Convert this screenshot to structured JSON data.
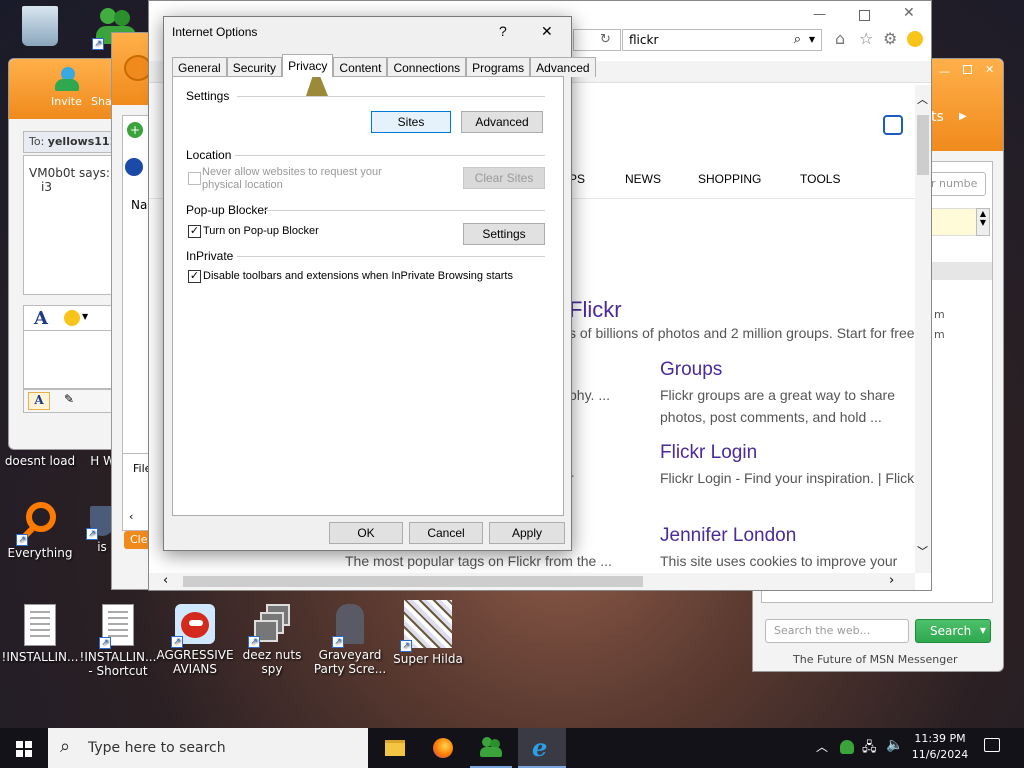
{
  "desktop": {
    "icons": [
      {
        "label": "doesnt load"
      },
      {
        "label": "Everything"
      },
      {
        "label": "is"
      },
      {
        "label": "!INSTALLIN..."
      },
      {
        "label": "!INSTALLIN... - Shortcut"
      },
      {
        "label": "AGGRESSIVE AVIANS"
      },
      {
        "label": "deez nuts spy"
      },
      {
        "label": "Graveyard Party Scre..."
      },
      {
        "label": "Super Hilda"
      },
      {
        "label": "H We"
      }
    ]
  },
  "msn_left": {
    "toolbar": {
      "invite": "Invite",
      "share": "Shar"
    },
    "to_label": "To:",
    "to_value": "yellows111",
    "message_sender": "VM0b0t says:",
    "message_text": "i3"
  },
  "msn_mid": {
    "name_fragment": "Na",
    "file_fragment": "File",
    "clear_fragment": "Clea"
  },
  "msn_right": {
    "header_text": "ts",
    "search_placeholder": "Search the web...",
    "search_button": "Search",
    "footer": "The Future of MSN Messenger",
    "field_placeholder": "r numbe",
    "list_frag1": "m",
    "list_frag2": "m"
  },
  "browser": {
    "address_value": "flickr",
    "nav": [
      "PS",
      "NEWS",
      "SHOPPING",
      "TOOLS"
    ],
    "result_main_title": "Flickr",
    "result_main_text": "s of billions of photos and 2 million groups. Start for free",
    "left_snippet1": "phy. ...",
    "left_snippet2": "r",
    "left_snippet3": "The most popular tags on Flickr from the ...",
    "results": [
      {
        "title": "Groups",
        "text1": "Flickr groups are a great way to share",
        "text2": "photos, post comments, and hold ..."
      },
      {
        "title": "Flickr Login",
        "text1": "Flickr Login - Find your inspiration. | Flick",
        "text2": ""
      },
      {
        "title": "Jennifer London",
        "text1": "This site uses cookies to improve your",
        "text2": ""
      }
    ]
  },
  "dialog": {
    "title": "Internet Options",
    "help": "?",
    "close": "✕",
    "tabs": [
      "General",
      "Security",
      "Privacy",
      "Content",
      "Connections",
      "Programs",
      "Advanced"
    ],
    "active_tab": "Privacy",
    "settings_group": "Settings",
    "sites_button": "Sites",
    "advanced_button": "Advanced",
    "location_group": "Location",
    "location_checkbox_line1": "Never allow websites to request your",
    "location_checkbox_line2": "physical location",
    "clear_sites_button": "Clear Sites",
    "popup_group": "Pop-up Blocker",
    "popup_checkbox": "Turn on Pop-up Blocker",
    "popup_settings_button": "Settings",
    "inprivate_group": "InPrivate",
    "inprivate_checkbox": "Disable toolbars and extensions when InPrivate Browsing starts",
    "ok_button": "OK",
    "cancel_button": "Cancel",
    "apply_button": "Apply",
    "popup_checked": true,
    "inprivate_checked": true,
    "location_checked": false
  },
  "taskbar": {
    "search_placeholder": "Type here to search",
    "time": "11:39 PM",
    "date": "11/6/2024"
  },
  "colors": {
    "accent": "#0078d7",
    "msn_orange": "#f39a2c",
    "msn_green": "#2fa84f",
    "link_purple": "#4b2a9a"
  }
}
